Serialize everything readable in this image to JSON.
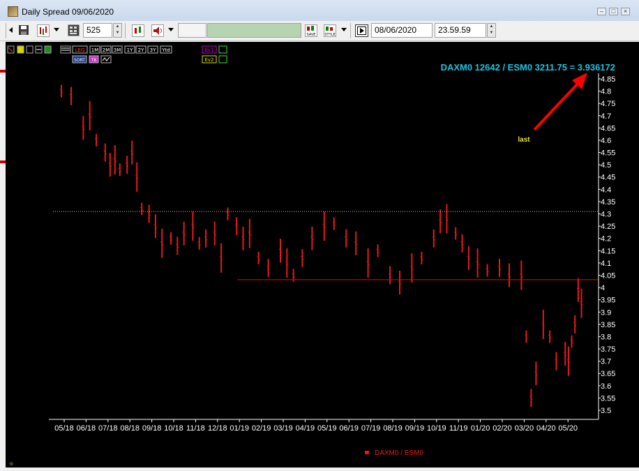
{
  "window": {
    "title": "Daily Spread 09/06/2020"
  },
  "toolbar": {
    "bars_value": "525",
    "save_label": "SAVE",
    "style_label": "STYLE",
    "date_value": "08/06/2020",
    "time_value": "23.59.59"
  },
  "indicator_strip": {
    "buttons": [
      "LEG",
      "1M",
      "2M",
      "3M",
      "1Y",
      "2Y",
      "3Y",
      "Ytd"
    ],
    "sort_label": "SORT",
    "tb_label": "TB",
    "ev1_label": "Ev1",
    "ev2_label": "Ev2"
  },
  "colors": {
    "background": "#000000",
    "series": "#e8191c",
    "annotation": "#1ac4e0",
    "last_label": "#e6e632",
    "arrow": "#ff0000",
    "dotted_line": "#c8c8c8",
    "support_line": "#ff0000"
  },
  "annotations": {
    "headline": "DAXM0 12642 / ESM0 3211.75 = 3.936172",
    "last_label": "last"
  },
  "chart_data": {
    "type": "bar",
    "subtype": "ohlc",
    "legend": "DAXM0 / ESM0",
    "legend_position": "bottom-center",
    "x_tick_labels": [
      "05/18",
      "06/18",
      "07/18",
      "08/18",
      "09/18",
      "10/18",
      "11/18",
      "12/18",
      "01/19",
      "02/19",
      "03/19",
      "04/19",
      "05/19",
      "06/19",
      "07/19",
      "08/19",
      "09/19",
      "10/19",
      "11/19",
      "01/20",
      "02/20",
      "03/20",
      "04/20",
      "05/20"
    ],
    "y_tick_labels": [
      "3.5",
      "3.55",
      "3.6",
      "3.65",
      "3.7",
      "3.75",
      "3.8",
      "3.85",
      "3.9",
      "3.95",
      "4",
      "4.05",
      "4.1",
      "4.15",
      "4.2",
      "4.25",
      "4.3",
      "4.35",
      "4.4",
      "4.45",
      "4.5",
      "4.55",
      "4.6",
      "4.65",
      "4.7",
      "4.75",
      "4.8",
      "4.85"
    ],
    "ylim": [
      3.47,
      4.87
    ],
    "y_axis_side": "right",
    "grid": false,
    "reference_lines": [
      {
        "style": "dotted",
        "value": 4.31,
        "x_from": "05/18"
      },
      {
        "style": "solid",
        "value": 4.032,
        "x_from": "01/19"
      }
    ],
    "last_value": 3.936172,
    "series": [
      {
        "name": "DAXM0 / ESM0",
        "points": [
          [
            "05/18",
            4.8
          ],
          [
            "05/18",
            4.78
          ],
          [
            "06/18",
            4.65
          ],
          [
            "06/18",
            4.7
          ],
          [
            "06/18",
            4.6
          ],
          [
            "07/18",
            4.55
          ],
          [
            "07/18",
            4.5
          ],
          [
            "07/18",
            4.52
          ],
          [
            "07/18",
            4.48
          ],
          [
            "08/18",
            4.5
          ],
          [
            "08/18",
            4.55
          ],
          [
            "08/18",
            4.45
          ],
          [
            "08/18",
            4.32
          ],
          [
            "09/18",
            4.3
          ],
          [
            "09/18",
            4.25
          ],
          [
            "09/18",
            4.18
          ],
          [
            "10/18",
            4.2
          ],
          [
            "10/18",
            4.17
          ],
          [
            "10/18",
            4.22
          ],
          [
            "11/18",
            4.25
          ],
          [
            "11/18",
            4.18
          ],
          [
            "11/18",
            4.2
          ],
          [
            "12/18",
            4.22
          ],
          [
            "12/18",
            4.12
          ],
          [
            "12/18",
            4.3
          ],
          [
            "01/19",
            4.25
          ],
          [
            "01/19",
            4.2
          ],
          [
            "01/19",
            4.22
          ],
          [
            "02/19",
            4.12
          ],
          [
            "02/19",
            4.08
          ],
          [
            "03/19",
            4.15
          ],
          [
            "03/19",
            4.1
          ],
          [
            "03/19",
            4.05
          ],
          [
            "04/19",
            4.12
          ],
          [
            "04/19",
            4.2
          ],
          [
            "05/19",
            4.25
          ],
          [
            "05/19",
            4.26
          ],
          [
            "06/19",
            4.2
          ],
          [
            "06/19",
            4.18
          ],
          [
            "07/19",
            4.1
          ],
          [
            "07/19",
            4.15
          ],
          [
            "08/19",
            4.05
          ],
          [
            "08/19",
            4.02
          ],
          [
            "09/19",
            4.08
          ],
          [
            "09/19",
            4.12
          ],
          [
            "10/19",
            4.2
          ],
          [
            "10/19",
            4.27
          ],
          [
            "10/19",
            4.28
          ],
          [
            "11/19",
            4.22
          ],
          [
            "11/19",
            4.18
          ],
          [
            "11/19",
            4.12
          ],
          [
            "01/20",
            4.1
          ],
          [
            "01/20",
            4.07
          ],
          [
            "02/20",
            4.08
          ],
          [
            "02/20",
            4.05
          ],
          [
            "03/20",
            4.05
          ],
          [
            "03/20",
            3.8
          ],
          [
            "03/20",
            3.55
          ],
          [
            "03/20",
            3.65
          ],
          [
            "04/20",
            3.85
          ],
          [
            "04/20",
            3.8
          ],
          [
            "04/20",
            3.7
          ],
          [
            "05/20",
            3.73
          ],
          [
            "05/20",
            3.7
          ],
          [
            "05/20",
            3.78
          ],
          [
            "05/20",
            3.85
          ],
          [
            "05/20",
            3.99
          ],
          [
            "05/20",
            3.936172
          ]
        ]
      }
    ]
  }
}
